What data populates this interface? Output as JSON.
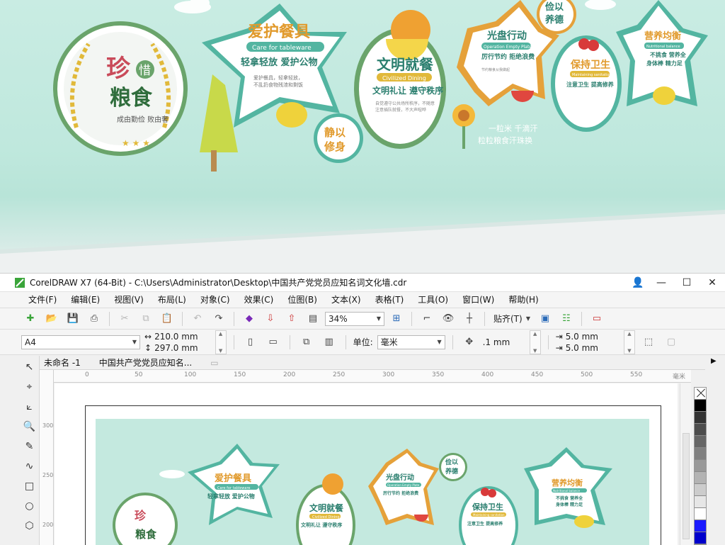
{
  "preview": {
    "circle_main": {
      "line1": "珍",
      "badge": "惜",
      "line2": "粮食",
      "sub": "成由勤俭 败由奢"
    },
    "star_tableware": {
      "title": "爱护餐具",
      "ribbon": "Care for tableware",
      "slogan": "轻拿轻放 爱护公物",
      "body": "爱护餐具，轻拿轻放，不乱扔食物残渣和剩饭"
    },
    "oval_civilized": {
      "title": "文明就餐",
      "ribbon": "Civilized Dining",
      "slogan": "文明礼让 遵守秩序"
    },
    "circle_quiet": {
      "text": "静以修身"
    },
    "star_plate": {
      "title": "光盘行动",
      "ribbon": "Operation Empty Plate",
      "slogan": "厉行节约 拒绝浪费"
    },
    "circle_frugal": {
      "text": "俭以养德"
    },
    "oval_hygiene": {
      "title": "保持卫生",
      "ribbon": "Maintaining sanitation",
      "slogan": "注意卫生 提高修养"
    },
    "star_nutrition": {
      "title": "营养均衡",
      "ribbon": "Nutritional balance",
      "slogan": "不挑食 营养全 身体棒 精力足"
    },
    "poem": {
      "line1": "一粒米 千滴汗",
      "line2": "粒粒粮食汗珠换"
    }
  },
  "window": {
    "title": "CorelDRAW X7 (64-Bit) - C:\\Users\\Administrator\\Desktop\\中国共产党党员应知名词文化墙.cdr",
    "controls": {
      "minimize": "—",
      "maximize": "☐",
      "close": "✕"
    }
  },
  "menu": [
    "文件(F)",
    "编辑(E)",
    "视图(V)",
    "布局(L)",
    "对象(C)",
    "效果(C)",
    "位图(B)",
    "文本(X)",
    "表格(T)",
    "工具(O)",
    "窗口(W)",
    "帮助(H)"
  ],
  "toolbar": {
    "zoom": "34%",
    "snap": "贴齐(T)"
  },
  "property_bar": {
    "page_size": "A4",
    "width": "210.0 mm",
    "height": "297.0 mm",
    "unit_label": "单位:",
    "unit": "毫米",
    "nudge": ".1 mm",
    "dup_x": "5.0 mm",
    "dup_y": "5.0 mm"
  },
  "doc_tabs": [
    "未命名 -1",
    "中国共产党党员应知名..."
  ],
  "ruler": {
    "marks": [
      "0",
      "50",
      "100",
      "150",
      "200",
      "250",
      "300",
      "350",
      "400",
      "450",
      "500",
      "550"
    ],
    "unit": "毫米"
  },
  "palette_colors": [
    "#000000",
    "#333333",
    "#4d4d4d",
    "#666666",
    "#808080",
    "#999999",
    "#b3b3b3",
    "#cccccc",
    "#e6e6e6",
    "#ffffff",
    "#1a1aff",
    "#0000cc"
  ]
}
